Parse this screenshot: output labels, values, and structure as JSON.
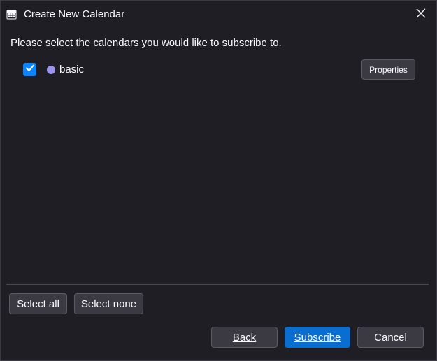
{
  "window": {
    "title": "Create New Calendar"
  },
  "prompt": "Please select the calendars you would like to subscribe to.",
  "calendars": [
    {
      "name": "basic",
      "checked": true,
      "color": "#9d94f0",
      "properties_label": "Properties"
    }
  ],
  "selection_buttons": {
    "select_all": "Select all",
    "select_none": "Select none"
  },
  "footer": {
    "back": "Back",
    "subscribe": "Subscribe",
    "cancel": "Cancel"
  },
  "colors": {
    "accent": "#0a84ff",
    "primary_button": "#0a6ed1",
    "background": "#1f1e25"
  },
  "icons": {
    "title": "calendar-icon",
    "close": "close-icon",
    "checkbox": "checkmark-icon"
  }
}
